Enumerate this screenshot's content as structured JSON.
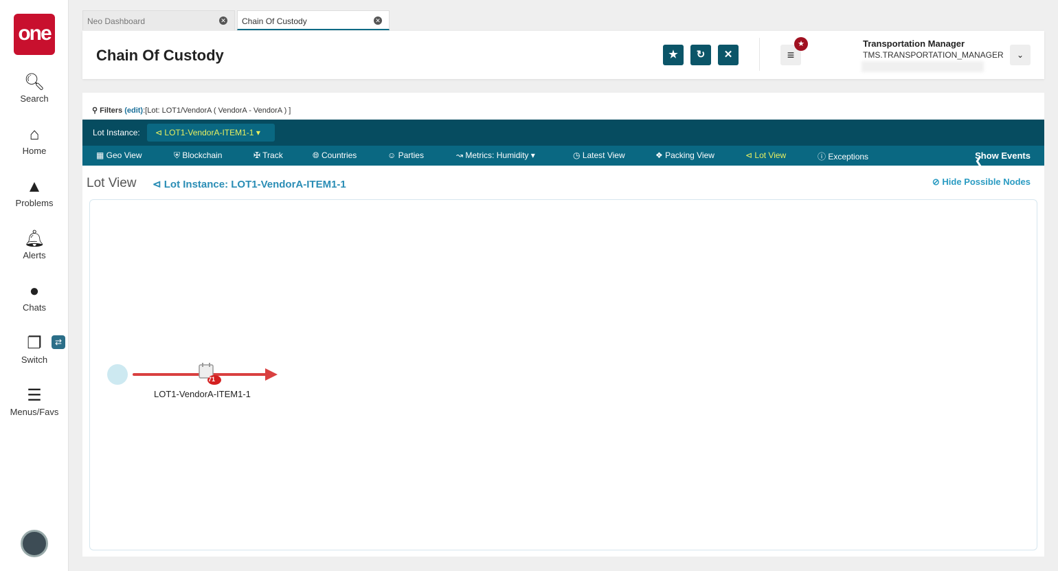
{
  "logo": "one",
  "sidebar": {
    "items": [
      {
        "label": "Search",
        "icon": "search-icon"
      },
      {
        "label": "Home",
        "icon": "home-icon"
      },
      {
        "label": "Problems",
        "icon": "warning-icon"
      },
      {
        "label": "Alerts",
        "icon": "bell-icon"
      },
      {
        "label": "Chats",
        "icon": "chat-icon"
      },
      {
        "label": "Switch",
        "icon": "switch-icon"
      },
      {
        "label": "Menus/Favs",
        "icon": "menu-icon"
      }
    ]
  },
  "tabs": [
    {
      "label": "Neo Dashboard"
    },
    {
      "label": "Chain Of Custody"
    }
  ],
  "header": {
    "title": "Chain Of Custody",
    "user_name": "Transportation Manager",
    "user_role": "TMS.TRANSPORTATION_MANAGER"
  },
  "filters": {
    "label": "Filters",
    "edit": "(edit)",
    "value": ":[Lot: LOT1/VendorA ( VendorA - VendorA ) ]"
  },
  "lot_instance": {
    "label": "Lot Instance:",
    "value": "LOT1-VendorA-ITEM1-1"
  },
  "nav": [
    "Geo View",
    "Blockchain",
    "Track",
    "Countries",
    "Parties",
    "Metrics: Humidity",
    "Latest View",
    "Packing View",
    "Lot View",
    "Exceptions"
  ],
  "show_events": "Show Events",
  "view": {
    "title": "Lot View",
    "instance": "Lot Instance: LOT1-VendorA-ITEM1-1",
    "hide_nodes": "Hide Possible Nodes"
  },
  "graph": {
    "node_label": "LOT1-VendorA-ITEM1-1",
    "event_count": "71"
  },
  "colors": {
    "accent": "#0a6882",
    "dark": "#064c60",
    "edge": "#d94040"
  }
}
